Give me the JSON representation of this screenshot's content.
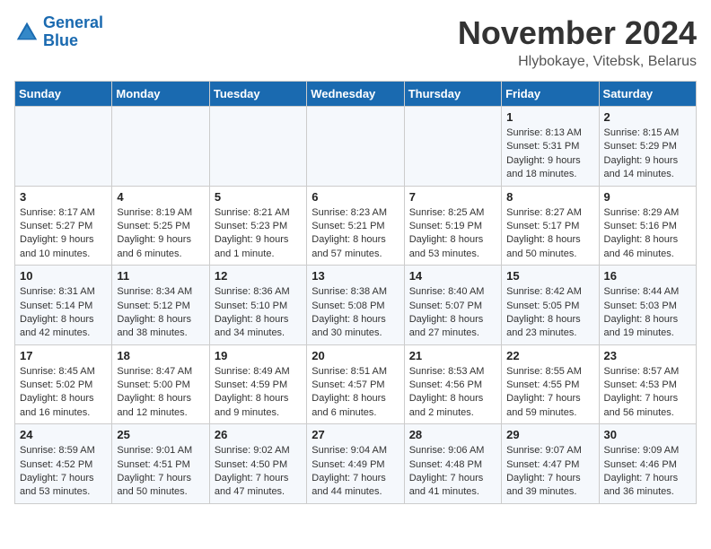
{
  "logo": {
    "line1": "General",
    "line2": "Blue"
  },
  "header": {
    "month": "November 2024",
    "location": "Hlybokaye, Vitebsk, Belarus"
  },
  "weekdays": [
    "Sunday",
    "Monday",
    "Tuesday",
    "Wednesday",
    "Thursday",
    "Friday",
    "Saturday"
  ],
  "weeks": [
    [
      {
        "day": "",
        "info": ""
      },
      {
        "day": "",
        "info": ""
      },
      {
        "day": "",
        "info": ""
      },
      {
        "day": "",
        "info": ""
      },
      {
        "day": "",
        "info": ""
      },
      {
        "day": "1",
        "info": "Sunrise: 8:13 AM\nSunset: 5:31 PM\nDaylight: 9 hours and 18 minutes."
      },
      {
        "day": "2",
        "info": "Sunrise: 8:15 AM\nSunset: 5:29 PM\nDaylight: 9 hours and 14 minutes."
      }
    ],
    [
      {
        "day": "3",
        "info": "Sunrise: 8:17 AM\nSunset: 5:27 PM\nDaylight: 9 hours and 10 minutes."
      },
      {
        "day": "4",
        "info": "Sunrise: 8:19 AM\nSunset: 5:25 PM\nDaylight: 9 hours and 6 minutes."
      },
      {
        "day": "5",
        "info": "Sunrise: 8:21 AM\nSunset: 5:23 PM\nDaylight: 9 hours and 1 minute."
      },
      {
        "day": "6",
        "info": "Sunrise: 8:23 AM\nSunset: 5:21 PM\nDaylight: 8 hours and 57 minutes."
      },
      {
        "day": "7",
        "info": "Sunrise: 8:25 AM\nSunset: 5:19 PM\nDaylight: 8 hours and 53 minutes."
      },
      {
        "day": "8",
        "info": "Sunrise: 8:27 AM\nSunset: 5:17 PM\nDaylight: 8 hours and 50 minutes."
      },
      {
        "day": "9",
        "info": "Sunrise: 8:29 AM\nSunset: 5:16 PM\nDaylight: 8 hours and 46 minutes."
      }
    ],
    [
      {
        "day": "10",
        "info": "Sunrise: 8:31 AM\nSunset: 5:14 PM\nDaylight: 8 hours and 42 minutes."
      },
      {
        "day": "11",
        "info": "Sunrise: 8:34 AM\nSunset: 5:12 PM\nDaylight: 8 hours and 38 minutes."
      },
      {
        "day": "12",
        "info": "Sunrise: 8:36 AM\nSunset: 5:10 PM\nDaylight: 8 hours and 34 minutes."
      },
      {
        "day": "13",
        "info": "Sunrise: 8:38 AM\nSunset: 5:08 PM\nDaylight: 8 hours and 30 minutes."
      },
      {
        "day": "14",
        "info": "Sunrise: 8:40 AM\nSunset: 5:07 PM\nDaylight: 8 hours and 27 minutes."
      },
      {
        "day": "15",
        "info": "Sunrise: 8:42 AM\nSunset: 5:05 PM\nDaylight: 8 hours and 23 minutes."
      },
      {
        "day": "16",
        "info": "Sunrise: 8:44 AM\nSunset: 5:03 PM\nDaylight: 8 hours and 19 minutes."
      }
    ],
    [
      {
        "day": "17",
        "info": "Sunrise: 8:45 AM\nSunset: 5:02 PM\nDaylight: 8 hours and 16 minutes."
      },
      {
        "day": "18",
        "info": "Sunrise: 8:47 AM\nSunset: 5:00 PM\nDaylight: 8 hours and 12 minutes."
      },
      {
        "day": "19",
        "info": "Sunrise: 8:49 AM\nSunset: 4:59 PM\nDaylight: 8 hours and 9 minutes."
      },
      {
        "day": "20",
        "info": "Sunrise: 8:51 AM\nSunset: 4:57 PM\nDaylight: 8 hours and 6 minutes."
      },
      {
        "day": "21",
        "info": "Sunrise: 8:53 AM\nSunset: 4:56 PM\nDaylight: 8 hours and 2 minutes."
      },
      {
        "day": "22",
        "info": "Sunrise: 8:55 AM\nSunset: 4:55 PM\nDaylight: 7 hours and 59 minutes."
      },
      {
        "day": "23",
        "info": "Sunrise: 8:57 AM\nSunset: 4:53 PM\nDaylight: 7 hours and 56 minutes."
      }
    ],
    [
      {
        "day": "24",
        "info": "Sunrise: 8:59 AM\nSunset: 4:52 PM\nDaylight: 7 hours and 53 minutes."
      },
      {
        "day": "25",
        "info": "Sunrise: 9:01 AM\nSunset: 4:51 PM\nDaylight: 7 hours and 50 minutes."
      },
      {
        "day": "26",
        "info": "Sunrise: 9:02 AM\nSunset: 4:50 PM\nDaylight: 7 hours and 47 minutes."
      },
      {
        "day": "27",
        "info": "Sunrise: 9:04 AM\nSunset: 4:49 PM\nDaylight: 7 hours and 44 minutes."
      },
      {
        "day": "28",
        "info": "Sunrise: 9:06 AM\nSunset: 4:48 PM\nDaylight: 7 hours and 41 minutes."
      },
      {
        "day": "29",
        "info": "Sunrise: 9:07 AM\nSunset: 4:47 PM\nDaylight: 7 hours and 39 minutes."
      },
      {
        "day": "30",
        "info": "Sunrise: 9:09 AM\nSunset: 4:46 PM\nDaylight: 7 hours and 36 minutes."
      }
    ]
  ]
}
